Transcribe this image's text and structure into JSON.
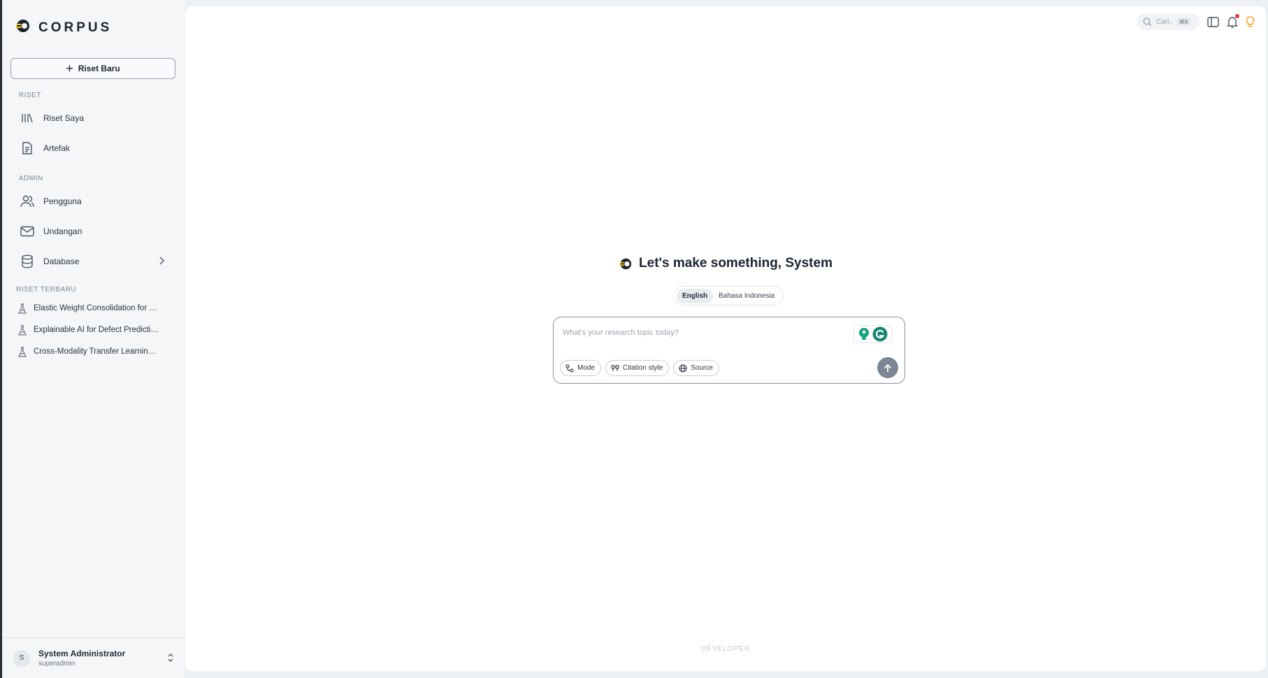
{
  "brand": {
    "name": "CORPUS"
  },
  "sidebar": {
    "new_button_label": "Riset Baru",
    "sections": {
      "riset": "RISET",
      "admin": "ADMIN",
      "recent": "RISET TERBARU"
    },
    "riset_items": [
      {
        "label": "Riset Saya",
        "icon": "library-icon"
      },
      {
        "label": "Artefak",
        "icon": "document-icon"
      }
    ],
    "admin_items": [
      {
        "label": "Pengguna",
        "icon": "users-icon"
      },
      {
        "label": "Undangan",
        "icon": "mail-icon"
      },
      {
        "label": "Database",
        "icon": "database-icon"
      }
    ],
    "recent_items": [
      {
        "label": "Elastic Weight Consolidation for R..."
      },
      {
        "label": "Explainable AI for Defect Predictio..."
      },
      {
        "label": "Cross-Modality Transfer Learning f..."
      }
    ]
  },
  "user": {
    "initial": "S",
    "name": "System Administrator",
    "role": "superadmin"
  },
  "topbar": {
    "search_placeholder": "Cari..",
    "search_shortcut": "⌘K"
  },
  "hero": {
    "title": "Let's make something, System"
  },
  "language": {
    "options": [
      "English",
      "Bahasa Indonesia"
    ],
    "selected": "English"
  },
  "composer": {
    "placeholder": "What's your research topic today?",
    "chips": [
      {
        "label": "Mode",
        "icon": "mode-icon"
      },
      {
        "label": "Citation style",
        "icon": "quote-icon"
      },
      {
        "label": "Source",
        "icon": "globe-icon"
      }
    ]
  },
  "footer": {
    "tag": "DEVELOPER"
  },
  "colors": {
    "brand_dark": "#1b2430",
    "brand_yellow": "#f5c518",
    "send_button": "#7b8794",
    "notification": "#e53935",
    "lightbulb": "#f0a020"
  }
}
